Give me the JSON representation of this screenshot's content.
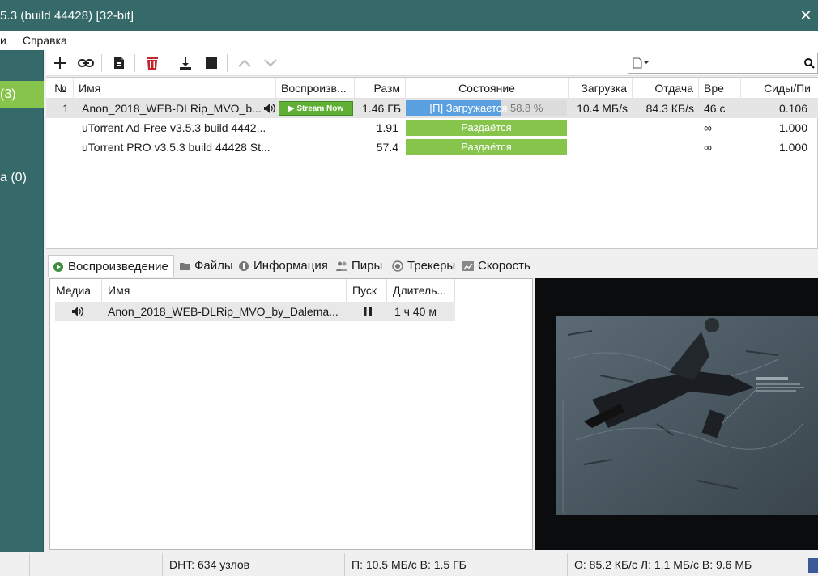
{
  "window": {
    "title": "5.3  (build 44428) [32-bit]"
  },
  "menu": {
    "items": [
      "и",
      "Справка"
    ]
  },
  "sidebar": {
    "items": [
      {
        "label": "(3)",
        "active": true
      },
      {
        "label": "а (0)",
        "active": false
      }
    ]
  },
  "toolbar": {
    "buttons": [
      "add-torrent",
      "add-url",
      "create-torrent",
      "remove",
      "start",
      "stop",
      "move-up",
      "move-down"
    ],
    "search_placeholder": ""
  },
  "torrents": {
    "columns": [
      "№",
      "Имя",
      "Воспроизв...",
      "Разм",
      "Состояние",
      "Загрузка",
      "Отдача",
      "Вре",
      "Сиды/Пи"
    ],
    "rows": [
      {
        "num": "1",
        "name": "Anon_2018_WEB-DLRip_MVO_b...",
        "play": "Stream Now",
        "size": "1.46 ГБ",
        "status": "[П] Загружается",
        "percent": "58.8 %",
        "progress": 0.588,
        "download": "10.4 МБ/s",
        "upload": "84.3 КБ/s",
        "eta": "46 с",
        "ratio": "0.106"
      },
      {
        "num": "",
        "name": "uTorrent Ad-Free v3.5.3 build 4442...",
        "play": "",
        "size": "1.91",
        "status": "Раздаётся",
        "percent": "",
        "progress": 1,
        "download": "",
        "upload": "",
        "eta": "∞",
        "ratio": "1.000"
      },
      {
        "num": "",
        "name": "uTorrent PRO v3.5.3 build 44428 St...",
        "play": "",
        "size": "57.4",
        "status": "Раздаётся",
        "percent": "",
        "progress": 1,
        "download": "",
        "upload": "",
        "eta": "∞",
        "ratio": "1.000"
      }
    ]
  },
  "tabs": [
    {
      "label": "Воспроизведение",
      "active": true
    },
    {
      "label": "Файлы",
      "active": false
    },
    {
      "label": "Информация",
      "active": false
    },
    {
      "label": "Пиры",
      "active": false
    },
    {
      "label": "Трекеры",
      "active": false
    },
    {
      "label": "Скорость",
      "active": false
    }
  ],
  "media": {
    "columns": [
      "Медиа",
      "Имя",
      "Пуск",
      "Длитель..."
    ],
    "rows": [
      {
        "name": "Anon_2018_WEB-DLRip_MVO_by_Dalema...",
        "duration": "1 ч 40 м"
      }
    ]
  },
  "statusbar": {
    "dht": "DHT: 634 узлов",
    "down": "П: 10.5 МБ/с В: 1.5 ГБ",
    "up": "О: 85.2 КБ/с Л: 1.1 МБ/с В: 9.6 МБ"
  },
  "colors": {
    "titlebar": "#36696a",
    "accent_green": "#86c44b",
    "progress_blue": "#5aa0e0"
  }
}
